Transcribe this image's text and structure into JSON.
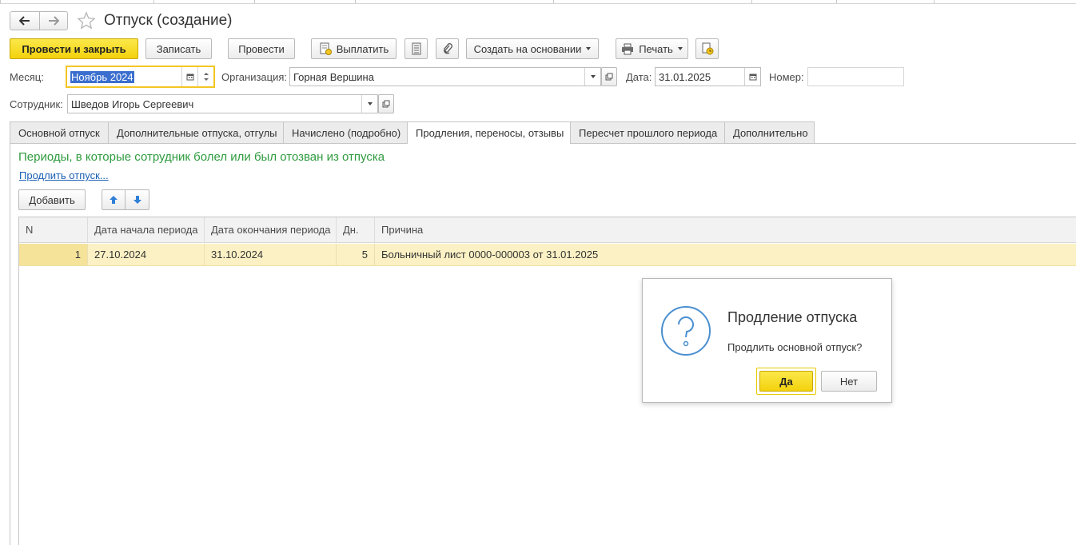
{
  "window": {
    "title": "Отпуск (создание)"
  },
  "toolbar": {
    "post_close": "Провести и закрыть",
    "save": "Записать",
    "post": "Провести",
    "pay": "Выплатить",
    "create_based": "Создать на основании",
    "print": "Печать"
  },
  "form": {
    "month_label": "Месяц:",
    "month_value": "Ноябрь 2024",
    "org_label": "Организация:",
    "org_value": "Горная Вершина",
    "date_label": "Дата:",
    "date_value": "31.01.2025",
    "number_label": "Номер:",
    "number_value": "",
    "employee_label": "Сотрудник:",
    "employee_value": "Шведов Игорь Сергеевич"
  },
  "tabs": [
    {
      "label": "Основной отпуск"
    },
    {
      "label": "Дополнительные отпуска, отгулы"
    },
    {
      "label": "Начислено (подробно)"
    },
    {
      "label": "Продления, переносы, отзывы"
    },
    {
      "label": "Пересчет прошлого периода"
    },
    {
      "label": "Дополнительно"
    }
  ],
  "active_tab": "Продления, переносы, отзывы",
  "section": {
    "heading": "Периоды, в которые сотрудник болел или был отозван из отпуска",
    "extend_link": "Продлить отпуск...",
    "add_button": "Добавить"
  },
  "table": {
    "columns": [
      "N",
      "Дата начала периода",
      "Дата окончания периода",
      "Дн.",
      "Причина"
    ],
    "rows": [
      {
        "n": "1",
        "start": "27.10.2024",
        "end": "31.10.2024",
        "days": "5",
        "reason": "Больничный лист 0000-000003 от 31.01.2025"
      }
    ]
  },
  "dialog": {
    "title": "Продление отпуска",
    "message": "Продлить основной отпуск?",
    "yes": "Да",
    "no": "Нет"
  },
  "colors": {
    "accent_yellow": "#f3d20c",
    "heading_green": "#2e9b3e",
    "link_blue": "#1a5fb4",
    "selected_row": "#fbf1c4",
    "dialog_icon_blue": "#4a8fd0"
  },
  "icons": [
    "back-arrow-icon",
    "forward-arrow-icon",
    "star-icon",
    "document-pay-icon",
    "list-icon",
    "paperclip-icon",
    "printer-icon",
    "document-clock-icon",
    "calendar-icon",
    "spin-icon",
    "open-icon",
    "arrow-up-icon",
    "arrow-down-icon",
    "question-icon"
  ]
}
